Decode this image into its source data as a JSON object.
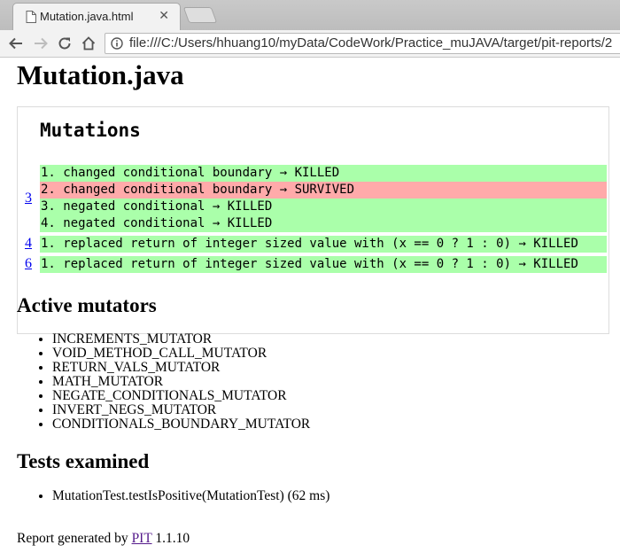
{
  "browser": {
    "tab_title": "Mutation.java.html",
    "close_glyph": "✕",
    "url": "file:///C:/Users/hhuang10/myData/CodeWork/Practice_muJAVA/target/pit-reports/2"
  },
  "page": {
    "title": "Mutation.java",
    "mutations_heading": "Mutations",
    "line_groups": [
      {
        "line": "3",
        "mutations": [
          {
            "text": "1. changed conditional boundary → KILLED",
            "status": "KILLED"
          },
          {
            "text": "2. changed conditional boundary → SURVIVED",
            "status": "SURVIVED"
          },
          {
            "text": "3. negated conditional → KILLED",
            "status": "KILLED"
          },
          {
            "text": "4. negated conditional → KILLED",
            "status": "KILLED"
          }
        ]
      },
      {
        "line": "4",
        "mutations": [
          {
            "text": "1. replaced return of integer sized value with (x == 0 ? 1 : 0) → KILLED",
            "status": "KILLED"
          }
        ]
      },
      {
        "line": "6",
        "mutations": [
          {
            "text": "1. replaced return of integer sized value with (x == 0 ? 1 : 0) → KILLED",
            "status": "KILLED"
          }
        ]
      }
    ],
    "active_mutators_heading": "Active mutators",
    "active_mutators": [
      "INCREMENTS_MUTATOR",
      "VOID_METHOD_CALL_MUTATOR",
      "RETURN_VALS_MUTATOR",
      "MATH_MUTATOR",
      "NEGATE_CONDITIONALS_MUTATOR",
      "INVERT_NEGS_MUTATOR",
      "CONDITIONALS_BOUNDARY_MUTATOR"
    ],
    "tests_heading": "Tests examined",
    "tests": [
      "MutationTest.testIsPositive(MutationTest) (62 ms)"
    ],
    "footer": {
      "prefix": "Report generated by ",
      "link": "PIT",
      "version": " 1.1.10"
    }
  },
  "colors": {
    "killed": "#aaffaa",
    "survived": "#ffaaaa",
    "link": "#0000ee",
    "visited_link": "#551a8b"
  },
  "icons": [
    "page-icon",
    "close-icon",
    "back-arrow-icon",
    "forward-arrow-icon",
    "reload-icon",
    "home-icon",
    "info-icon"
  ]
}
